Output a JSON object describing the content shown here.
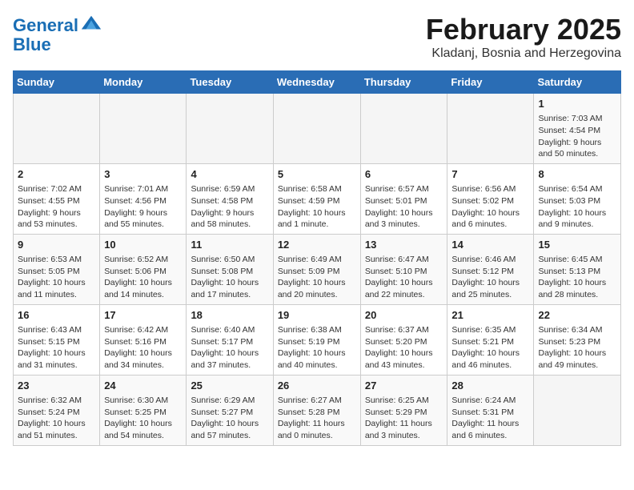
{
  "logo": {
    "line1": "General",
    "line2": "Blue"
  },
  "title": "February 2025",
  "location": "Kladanj, Bosnia and Herzegovina",
  "days_of_week": [
    "Sunday",
    "Monday",
    "Tuesday",
    "Wednesday",
    "Thursday",
    "Friday",
    "Saturday"
  ],
  "weeks": [
    [
      {
        "num": "",
        "info": ""
      },
      {
        "num": "",
        "info": ""
      },
      {
        "num": "",
        "info": ""
      },
      {
        "num": "",
        "info": ""
      },
      {
        "num": "",
        "info": ""
      },
      {
        "num": "",
        "info": ""
      },
      {
        "num": "1",
        "info": "Sunrise: 7:03 AM\nSunset: 4:54 PM\nDaylight: 9 hours and 50 minutes."
      }
    ],
    [
      {
        "num": "2",
        "info": "Sunrise: 7:02 AM\nSunset: 4:55 PM\nDaylight: 9 hours and 53 minutes."
      },
      {
        "num": "3",
        "info": "Sunrise: 7:01 AM\nSunset: 4:56 PM\nDaylight: 9 hours and 55 minutes."
      },
      {
        "num": "4",
        "info": "Sunrise: 6:59 AM\nSunset: 4:58 PM\nDaylight: 9 hours and 58 minutes."
      },
      {
        "num": "5",
        "info": "Sunrise: 6:58 AM\nSunset: 4:59 PM\nDaylight: 10 hours and 1 minute."
      },
      {
        "num": "6",
        "info": "Sunrise: 6:57 AM\nSunset: 5:01 PM\nDaylight: 10 hours and 3 minutes."
      },
      {
        "num": "7",
        "info": "Sunrise: 6:56 AM\nSunset: 5:02 PM\nDaylight: 10 hours and 6 minutes."
      },
      {
        "num": "8",
        "info": "Sunrise: 6:54 AM\nSunset: 5:03 PM\nDaylight: 10 hours and 9 minutes."
      }
    ],
    [
      {
        "num": "9",
        "info": "Sunrise: 6:53 AM\nSunset: 5:05 PM\nDaylight: 10 hours and 11 minutes."
      },
      {
        "num": "10",
        "info": "Sunrise: 6:52 AM\nSunset: 5:06 PM\nDaylight: 10 hours and 14 minutes."
      },
      {
        "num": "11",
        "info": "Sunrise: 6:50 AM\nSunset: 5:08 PM\nDaylight: 10 hours and 17 minutes."
      },
      {
        "num": "12",
        "info": "Sunrise: 6:49 AM\nSunset: 5:09 PM\nDaylight: 10 hours and 20 minutes."
      },
      {
        "num": "13",
        "info": "Sunrise: 6:47 AM\nSunset: 5:10 PM\nDaylight: 10 hours and 22 minutes."
      },
      {
        "num": "14",
        "info": "Sunrise: 6:46 AM\nSunset: 5:12 PM\nDaylight: 10 hours and 25 minutes."
      },
      {
        "num": "15",
        "info": "Sunrise: 6:45 AM\nSunset: 5:13 PM\nDaylight: 10 hours and 28 minutes."
      }
    ],
    [
      {
        "num": "16",
        "info": "Sunrise: 6:43 AM\nSunset: 5:15 PM\nDaylight: 10 hours and 31 minutes."
      },
      {
        "num": "17",
        "info": "Sunrise: 6:42 AM\nSunset: 5:16 PM\nDaylight: 10 hours and 34 minutes."
      },
      {
        "num": "18",
        "info": "Sunrise: 6:40 AM\nSunset: 5:17 PM\nDaylight: 10 hours and 37 minutes."
      },
      {
        "num": "19",
        "info": "Sunrise: 6:38 AM\nSunset: 5:19 PM\nDaylight: 10 hours and 40 minutes."
      },
      {
        "num": "20",
        "info": "Sunrise: 6:37 AM\nSunset: 5:20 PM\nDaylight: 10 hours and 43 minutes."
      },
      {
        "num": "21",
        "info": "Sunrise: 6:35 AM\nSunset: 5:21 PM\nDaylight: 10 hours and 46 minutes."
      },
      {
        "num": "22",
        "info": "Sunrise: 6:34 AM\nSunset: 5:23 PM\nDaylight: 10 hours and 49 minutes."
      }
    ],
    [
      {
        "num": "23",
        "info": "Sunrise: 6:32 AM\nSunset: 5:24 PM\nDaylight: 10 hours and 51 minutes."
      },
      {
        "num": "24",
        "info": "Sunrise: 6:30 AM\nSunset: 5:25 PM\nDaylight: 10 hours and 54 minutes."
      },
      {
        "num": "25",
        "info": "Sunrise: 6:29 AM\nSunset: 5:27 PM\nDaylight: 10 hours and 57 minutes."
      },
      {
        "num": "26",
        "info": "Sunrise: 6:27 AM\nSunset: 5:28 PM\nDaylight: 11 hours and 0 minutes."
      },
      {
        "num": "27",
        "info": "Sunrise: 6:25 AM\nSunset: 5:29 PM\nDaylight: 11 hours and 3 minutes."
      },
      {
        "num": "28",
        "info": "Sunrise: 6:24 AM\nSunset: 5:31 PM\nDaylight: 11 hours and 6 minutes."
      },
      {
        "num": "",
        "info": ""
      }
    ]
  ]
}
